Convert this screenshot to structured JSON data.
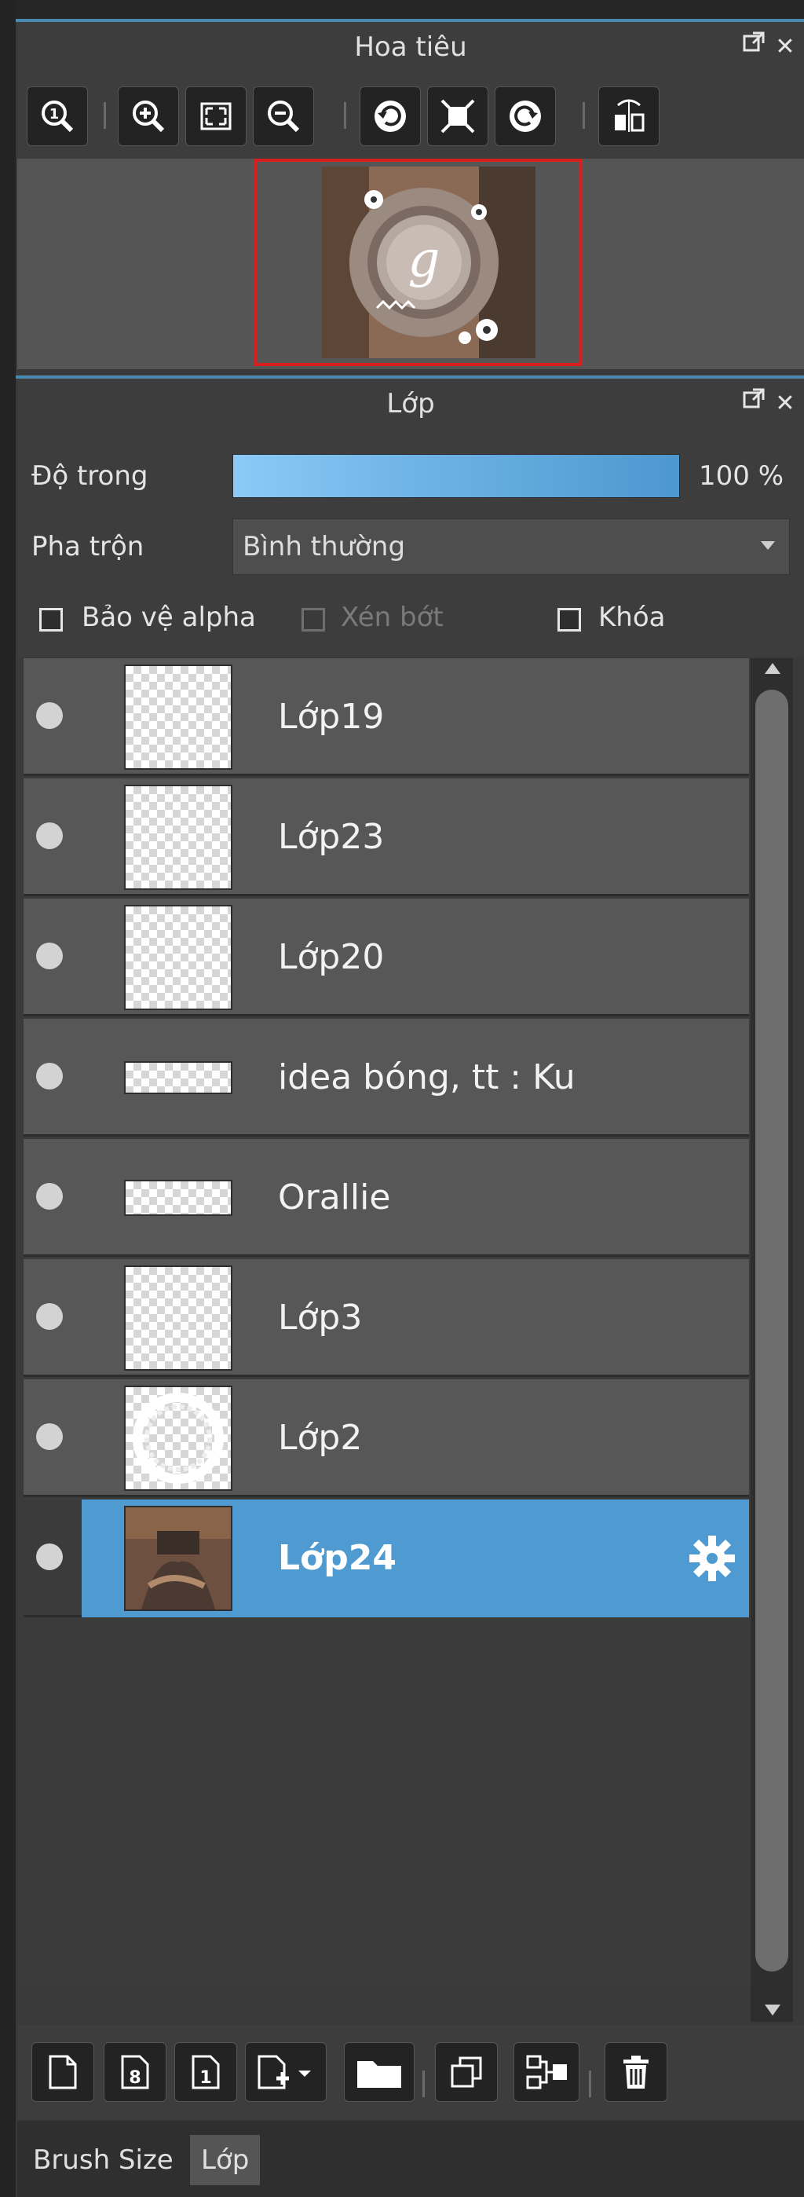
{
  "navigator": {
    "title": "Hoa tiêu",
    "undock_icon": "undock-icon",
    "close_icon": "close-icon",
    "toolbar": [
      {
        "name": "zoom-actual-button",
        "icon": "zoom-1-icon"
      },
      {
        "name": "zoom-in-button",
        "icon": "zoom-in-icon"
      },
      {
        "name": "fit-window-button",
        "icon": "fit-window-icon"
      },
      {
        "name": "zoom-out-button",
        "icon": "zoom-out-icon"
      },
      {
        "name": "rotate-left-button",
        "icon": "rotate-left-icon"
      },
      {
        "name": "fit-view-button",
        "icon": "fit-view-icon"
      },
      {
        "name": "rotate-right-button",
        "icon": "rotate-right-icon"
      },
      {
        "name": "flip-horizontal-button",
        "icon": "flip-horizontal-icon"
      }
    ]
  },
  "layers_panel": {
    "title": "Lớp",
    "opacity_label": "Độ trong",
    "opacity_value": "100 %",
    "opacity_fraction": 1.0,
    "blend_label": "Pha trộn",
    "blend_value": "Bình thường",
    "protect_alpha_label": "Bảo vệ alpha",
    "clipping_label": "Xén bớt",
    "lock_label": "Khóa",
    "layers": [
      {
        "name": "Lớp19",
        "visible": true,
        "selected": false,
        "thumb": "square"
      },
      {
        "name": "Lớp23",
        "visible": true,
        "selected": false,
        "thumb": "square"
      },
      {
        "name": "Lớp20",
        "visible": true,
        "selected": false,
        "thumb": "square"
      },
      {
        "name": "idea bóng, tt : Ku",
        "visible": true,
        "selected": false,
        "thumb": "wide"
      },
      {
        "name": "Orallie",
        "visible": true,
        "selected": false,
        "thumb": "wide"
      },
      {
        "name": "Lớp3",
        "visible": true,
        "selected": false,
        "thumb": "square"
      },
      {
        "name": "Lớp2",
        "visible": true,
        "selected": false,
        "thumb": "ring"
      },
      {
        "name": "Lớp24",
        "visible": true,
        "selected": true,
        "thumb": "photo"
      }
    ],
    "bottom_toolbar": [
      {
        "name": "new-layer-button",
        "icon": "new-page-icon"
      },
      {
        "name": "new-8bit-layer-button",
        "icon": "layer-8-icon"
      },
      {
        "name": "new-1bit-layer-button",
        "icon": "layer-1-icon"
      },
      {
        "name": "add-layer-menu-button",
        "icon": "add-layer-dropdown-icon"
      },
      {
        "name": "new-folder-button",
        "icon": "folder-icon"
      },
      {
        "name": "duplicate-layer-button",
        "icon": "duplicate-icon"
      },
      {
        "name": "merge-down-button",
        "icon": "merge-icon"
      },
      {
        "name": "delete-layer-button",
        "icon": "trash-icon"
      }
    ]
  },
  "tabs": [
    {
      "label": "Brush Size",
      "active": false
    },
    {
      "label": "Lớp",
      "active": true
    }
  ],
  "colors": {
    "selected_row": "#4f9ad0",
    "navigator_frame": "#d81f1f",
    "opacity_bar_start": "#8ccaf7",
    "opacity_bar_end": "#4d97cf"
  }
}
